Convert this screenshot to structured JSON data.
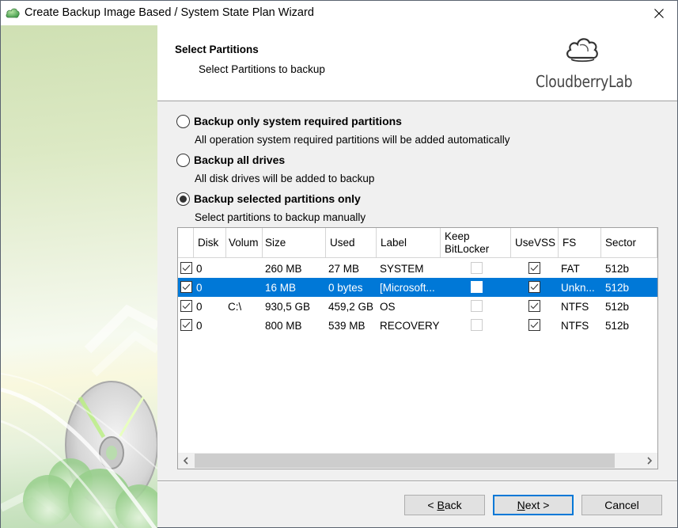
{
  "window": {
    "title": "Create Backup Image Based / System State Plan Wizard",
    "close_label": "×"
  },
  "header": {
    "title": "Select Partitions",
    "subtitle": "Select Partitions to backup",
    "logo_text": "CloudberryLab"
  },
  "options": [
    {
      "label": "Backup only system required partitions",
      "description": "All operation system required partitions will be added automatically",
      "checked": false
    },
    {
      "label": "Backup all drives",
      "description": "All disk drives will be added to backup",
      "checked": false
    },
    {
      "label": "Backup selected partitions only",
      "description": "Select partitions to backup manually",
      "checked": true
    }
  ],
  "grid": {
    "columns": [
      "",
      "Disk",
      "Volum",
      "Size",
      "Used",
      "Label",
      "Keep BitLocker",
      "UseVSS",
      "FS",
      "Sector"
    ],
    "column_keep_line1": "Keep",
    "column_keep_line2": "BitLocker",
    "rows": [
      {
        "selected_cb": true,
        "disk": "0",
        "volume": "",
        "size": "260 MB",
        "used": "27 MB",
        "label": "SYSTEM",
        "keep_bitlocker": false,
        "use_vss": true,
        "fs": "FAT",
        "sector": "512b",
        "highlighted": false
      },
      {
        "selected_cb": true,
        "disk": "0",
        "volume": "",
        "size": "16 MB",
        "used": "0 bytes",
        "label": "[Microsoft...",
        "keep_bitlocker": false,
        "use_vss": true,
        "fs": "Unkn...",
        "sector": "512b",
        "highlighted": true
      },
      {
        "selected_cb": true,
        "disk": "0",
        "volume": "C:\\",
        "size": "930,5 GB",
        "used": "459,2 GB",
        "label": "OS",
        "keep_bitlocker": false,
        "use_vss": true,
        "fs": "NTFS",
        "sector": "512b",
        "highlighted": false
      },
      {
        "selected_cb": true,
        "disk": "0",
        "volume": "",
        "size": "800 MB",
        "used": "539 MB",
        "label": "RECOVERY",
        "keep_bitlocker": false,
        "use_vss": true,
        "fs": "NTFS",
        "sector": "512b",
        "highlighted": false
      }
    ]
  },
  "buttons": {
    "back_prefix": "< ",
    "back_mnemonic": "B",
    "back_rest": "ack",
    "next_mnemonic": "N",
    "next_rest": "ext >",
    "cancel": "Cancel"
  },
  "colors": {
    "selection": "#0078d7",
    "default_button_border": "#0078d7"
  }
}
